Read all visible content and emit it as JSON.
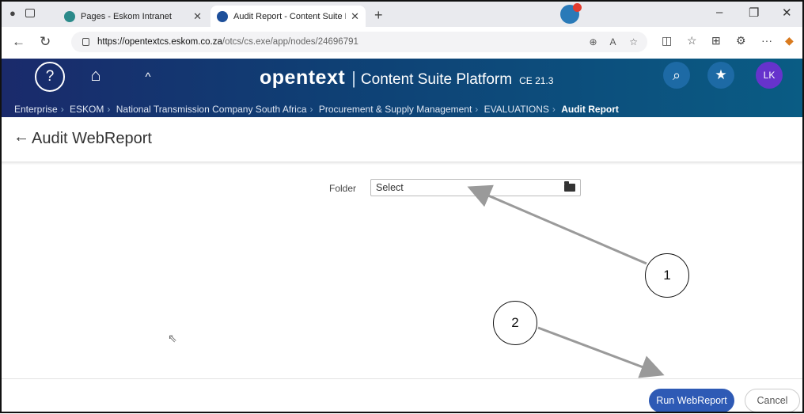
{
  "browser": {
    "tabs": [
      {
        "title": "Pages - Eskom Intranet",
        "active": false
      },
      {
        "title": "Audit Report - Content Suite Platf",
        "active": true
      }
    ],
    "url_host": "https://opentextcs.eskom.co.za",
    "url_path": "/otcs/cs.exe/app/nodes/24696791",
    "icons": [
      "back-icon",
      "refresh-icon",
      "lock-icon",
      "zoom-icon",
      "read-aloud-icon",
      "favorite-icon",
      "split-screen-icon",
      "favorites-bar-icon",
      "collections-icon",
      "extensions-icon",
      "more-icon",
      "copilot-icon"
    ]
  },
  "header": {
    "logo": "opentext",
    "product": "Content Suite Platform",
    "version": "CE 21.3",
    "avatar_initials": "LK",
    "colors": {
      "start": "#1a2a6b",
      "end": "#0a5c84",
      "accent": "#2e5ab5"
    }
  },
  "breadcrumb": [
    "Enterprise",
    "ESKOM",
    "National Transmission Company South Africa",
    "Procurement & Supply Management",
    "EVALUATIONS",
    "Audit Report"
  ],
  "page": {
    "title": "Audit WebReport",
    "folder_label": "Folder",
    "folder_placeholder": "Select"
  },
  "footer": {
    "run_label": "Run WebReport",
    "cancel_label": "Cancel"
  },
  "annotations": [
    "1",
    "2"
  ]
}
